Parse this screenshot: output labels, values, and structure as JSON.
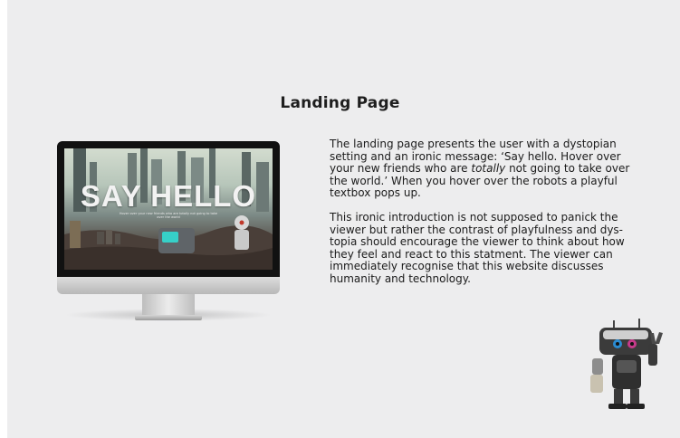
{
  "page": {
    "title": "Landing Page"
  },
  "monitor_screen": {
    "heading": "SAY HELLO",
    "caption": "Hover over your new friends who are totally not going to take over the world"
  },
  "description": {
    "paragraph_1": {
      "before_em": "The landing page presents the user with a dystopian setting and an ironic message: ‘Say hello. Hover over your new friends who are ",
      "em": "totally",
      "after_em": " not going to take over the world.’ When you hover over the robots a playful textbox pops up."
    },
    "paragraph_2": "This ironic introduction is not supposed to panick the viewer but rather the contrast of playfulness and dys-topia should encourage the viewer to think about how they feel and react to this statment. The viewer can immediately recognise that this website discusses humanity and technology."
  },
  "colors": {
    "background": "#ededee",
    "text": "#1b1b1b",
    "bezel": "#111111"
  },
  "icons": {
    "monitor": "imac-monitor-icon",
    "robot": "robot-illustration"
  }
}
